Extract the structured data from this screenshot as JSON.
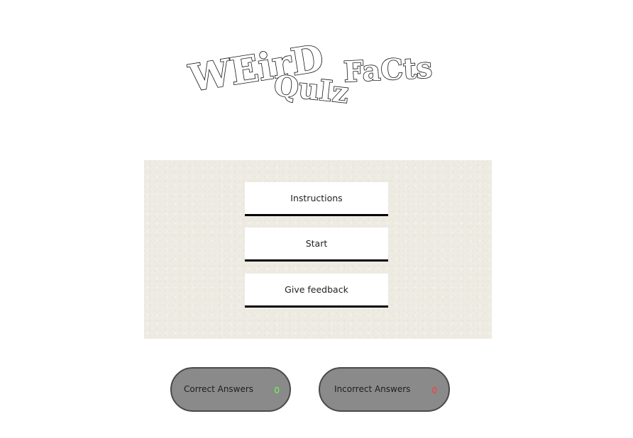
{
  "logo": {
    "word_weird": "WEirD",
    "word_quiz": "QuIz",
    "word_facts": "FaCts"
  },
  "menu": {
    "instructions_label": "Instructions",
    "start_label": "Start",
    "feedback_label": "Give feedback"
  },
  "score": {
    "correct_label": "Correct Answers",
    "correct_value": "0",
    "incorrect_label": "Incorrect Answers",
    "incorrect_value": "0"
  },
  "colors": {
    "panel_background": "#eeebe3",
    "correct_value": "#6dff4f",
    "incorrect_value": "#ff3b2f",
    "score_pill": "#8a8a8a"
  }
}
